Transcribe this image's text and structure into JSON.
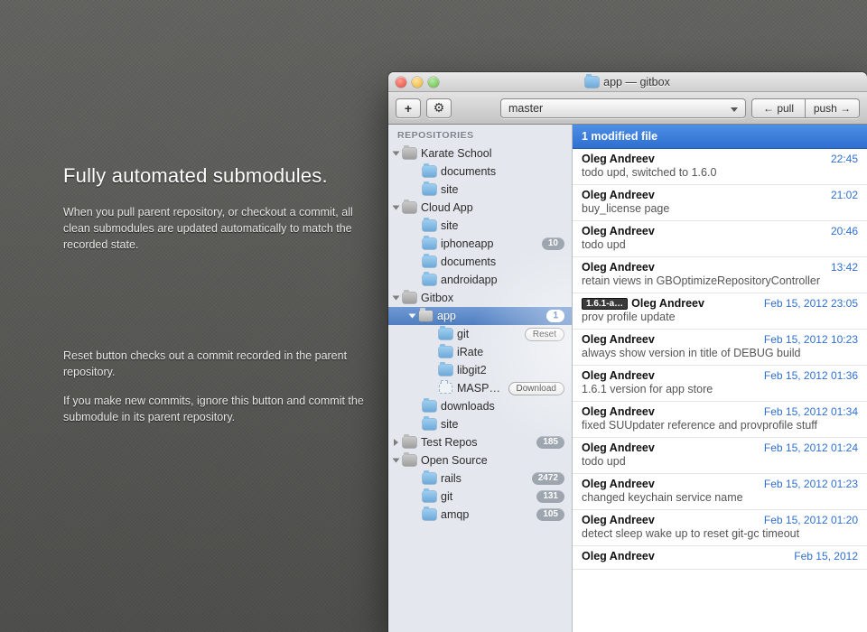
{
  "promo": {
    "headline": "Fully automated submodules.",
    "body": "When you pull parent repository, or checkout a commit, all clean submodules are updated automatically to match the recorded state."
  },
  "caption": {
    "p1": "Reset button checks out a commit recorded in the parent repository.",
    "p2": "If you make new commits, ignore this button and commit the submodule in its parent repository."
  },
  "window": {
    "title": "app — gitbox",
    "branch": "master",
    "pull_label": "← pull",
    "push_label": "push →"
  },
  "sidebar": {
    "header": "REPOSITORIES",
    "reset_label": "Reset",
    "download_label": "Download",
    "groups": [
      {
        "name": "Karate School",
        "children": [
          {
            "name": "documents"
          },
          {
            "name": "site"
          }
        ]
      },
      {
        "name": "Cloud App",
        "children": [
          {
            "name": "site"
          },
          {
            "name": "iphoneapp",
            "badge": "10"
          },
          {
            "name": "documents"
          },
          {
            "name": "androidapp"
          }
        ]
      },
      {
        "name": "Gitbox",
        "children": [
          {
            "name": "app",
            "badge": "1",
            "selected": true,
            "children": [
              {
                "name": "git",
                "action": "reset"
              },
              {
                "name": "iRate"
              },
              {
                "name": "libgit2"
              },
              {
                "name": "MASPref…",
                "action": "download",
                "dashed": true
              }
            ]
          },
          {
            "name": "downloads"
          },
          {
            "name": "site"
          }
        ]
      },
      {
        "name": "Test Repos",
        "badge": "185",
        "closed": true
      },
      {
        "name": "Open Source",
        "children": [
          {
            "name": "rails",
            "badge": "2472"
          },
          {
            "name": "git",
            "badge": "131"
          },
          {
            "name": "amqp",
            "badge": "105"
          }
        ]
      }
    ]
  },
  "list": {
    "banner": "1 modified file",
    "commits": [
      {
        "author": "Oleg Andreev",
        "time": "22:45",
        "msg": "todo upd, switched to 1.6.0"
      },
      {
        "author": "Oleg Andreev",
        "time": "21:02",
        "msg": "buy_license page"
      },
      {
        "author": "Oleg Andreev",
        "time": "20:46",
        "msg": "todo upd"
      },
      {
        "author": "Oleg Andreev",
        "time": "13:42",
        "msg": "retain views in GBOptimizeRepositoryController"
      },
      {
        "author": "Oleg Andreev",
        "time": "Feb 15, 2012 23:05",
        "msg": "prov profile update",
        "tag": "1.6.1-a…"
      },
      {
        "author": "Oleg Andreev",
        "time": "Feb 15, 2012 10:23",
        "msg": "always show version in title of DEBUG build"
      },
      {
        "author": "Oleg Andreev",
        "time": "Feb 15, 2012 01:36",
        "msg": "1.6.1 version for app store"
      },
      {
        "author": "Oleg Andreev",
        "time": "Feb 15, 2012 01:34",
        "msg": "fixed SUUpdater reference and provprofile stuff"
      },
      {
        "author": "Oleg Andreev",
        "time": "Feb 15, 2012 01:24",
        "msg": "todo upd"
      },
      {
        "author": "Oleg Andreev",
        "time": "Feb 15, 2012 01:23",
        "msg": "changed keychain service name"
      },
      {
        "author": "Oleg Andreev",
        "time": "Feb 15, 2012 01:20",
        "msg": "detect sleep wake up to reset git-gc timeout"
      },
      {
        "author": "Oleg Andreev",
        "time": "Feb 15, 2012",
        "msg": ""
      }
    ]
  }
}
